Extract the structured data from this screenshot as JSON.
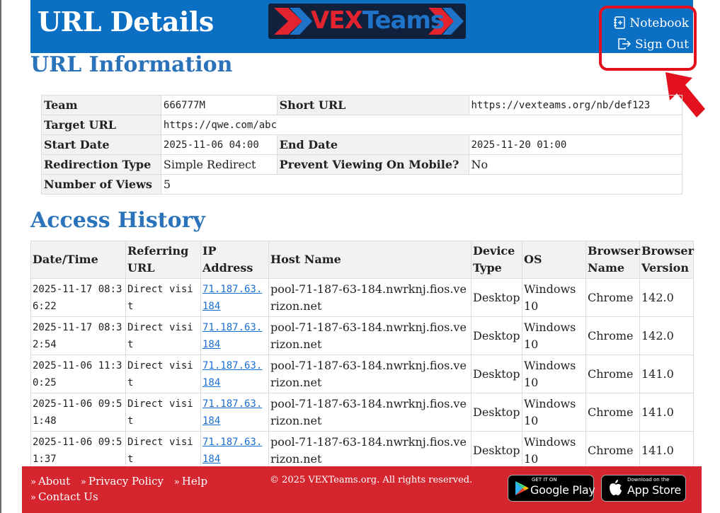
{
  "header": {
    "title": "URL Details",
    "logo": {
      "part1": "VEX",
      "part2": "Teams"
    },
    "links": {
      "notebook": "Notebook",
      "signout": "Sign Out"
    }
  },
  "info": {
    "title": "URL Information",
    "team_label": "Team",
    "team": "666777M",
    "short_url_label": "Short URL",
    "short_url": "https://vexteams.org/nb/def123",
    "target_url_label": "Target URL",
    "target_url": "https://qwe.com/abc",
    "start_date_label": "Start Date",
    "start_date": "2025-11-06 04:00",
    "end_date_label": "End Date",
    "end_date": "2025-11-20 01:00",
    "redirection_type_label": "Redirection Type",
    "redirection_type": "Simple Redirect",
    "prevent_mobile_label": "Prevent Viewing On Mobile?",
    "prevent_mobile": "No",
    "views_label": "Number of Views",
    "views": "5"
  },
  "history": {
    "title": "Access History",
    "columns": [
      "Date/Time",
      "Referring URL",
      "IP Address",
      "Host Name",
      "Device Type",
      "OS",
      "Browser Name",
      "Browser Version"
    ],
    "rows": [
      [
        "2025-11-17 08:36:22",
        "Direct visit",
        "71.187.63.184",
        "pool-71-187-63-184.nwrknj.fios.verizon.net",
        "Desktop",
        "Windows 10",
        "Chrome",
        "142.0"
      ],
      [
        "2025-11-17 08:32:54",
        "Direct visit",
        "71.187.63.184",
        "pool-71-187-63-184.nwrknj.fios.verizon.net",
        "Desktop",
        "Windows 10",
        "Chrome",
        "142.0"
      ],
      [
        "2025-11-06 11:30:25",
        "Direct visit",
        "71.187.63.184",
        "pool-71-187-63-184.nwrknj.fios.verizon.net",
        "Desktop",
        "Windows 10",
        "Chrome",
        "141.0"
      ],
      [
        "2025-11-06 09:51:48",
        "Direct visit",
        "71.187.63.184",
        "pool-71-187-63-184.nwrknj.fios.verizon.net",
        "Desktop",
        "Windows 10",
        "Chrome",
        "141.0"
      ],
      [
        "2025-11-06 09:51:37",
        "Direct visit",
        "71.187.63.184",
        "pool-71-187-63-184.nwrknj.fios.verizon.net",
        "Desktop",
        "Windows 10",
        "Chrome",
        "141.0"
      ]
    ]
  },
  "footer": {
    "links": [
      "About",
      "Privacy Policy",
      "Help",
      "Contact Us"
    ],
    "copyright": "© 2025 VEXTeams.org. All rights reserved.",
    "google_play": {
      "small": "GET IT ON",
      "big": "Google Play"
    },
    "app_store": {
      "small": "Download on the",
      "big": "App Store"
    }
  },
  "colors": {
    "header_bg": "#0b6fc4",
    "heading": "#2a73ba",
    "footer_bg": "#d5252f",
    "highlight": "#e3101e",
    "link": "#1a6fd1"
  },
  "icons": {
    "notebook": "notebook-plus-icon",
    "signout": "sign-out-icon",
    "chevron": "double-chevron-right-icon",
    "annotation": "red-arrow-icon"
  }
}
